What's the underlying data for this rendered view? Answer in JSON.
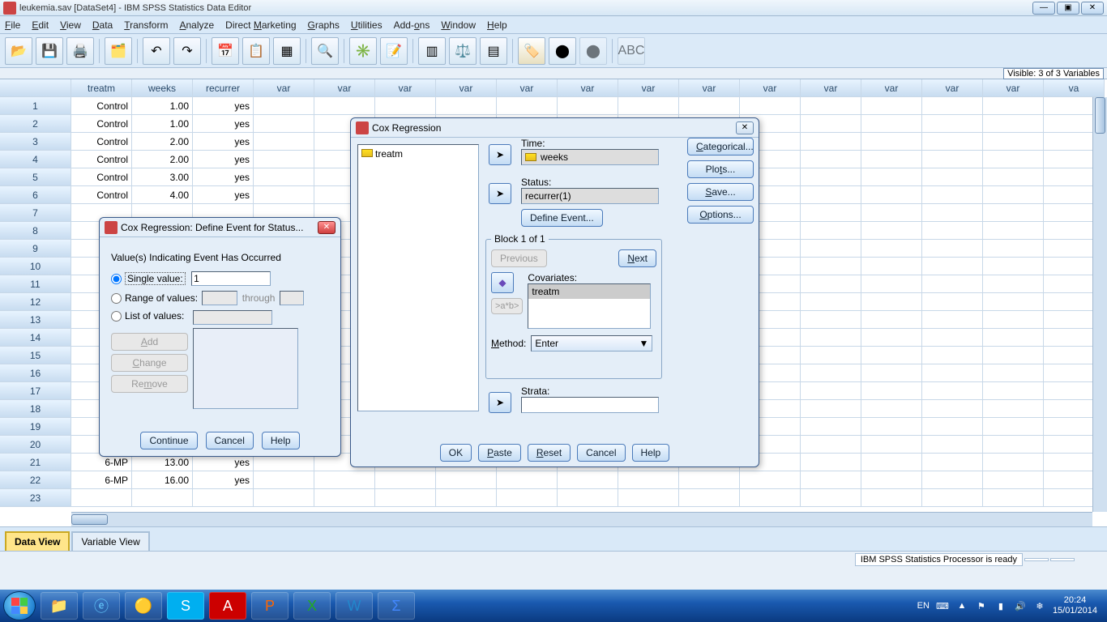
{
  "window": {
    "title": "leukemia.sav [DataSet4] - IBM SPSS Statistics Data Editor"
  },
  "menu": [
    "File",
    "Edit",
    "View",
    "Data",
    "Transform",
    "Analyze",
    "Direct Marketing",
    "Graphs",
    "Utilities",
    "Add-ons",
    "Window",
    "Help"
  ],
  "visible": "Visible: 3 of 3 Variables",
  "columns": [
    "treatm",
    "weeks",
    "recurrer",
    "var",
    "var",
    "var",
    "var",
    "var",
    "var",
    "var",
    "var",
    "var",
    "var",
    "var",
    "var",
    "var",
    "va"
  ],
  "rows": [
    {
      "n": "1",
      "c": [
        "Control",
        "1.00",
        "yes"
      ]
    },
    {
      "n": "2",
      "c": [
        "Control",
        "1.00",
        "yes"
      ]
    },
    {
      "n": "3",
      "c": [
        "Control",
        "2.00",
        "yes"
      ]
    },
    {
      "n": "4",
      "c": [
        "Control",
        "2.00",
        "yes"
      ]
    },
    {
      "n": "5",
      "c": [
        "Control",
        "3.00",
        "yes"
      ]
    },
    {
      "n": "6",
      "c": [
        "Control",
        "4.00",
        "yes"
      ]
    },
    {
      "n": "7",
      "c": [
        "",
        "",
        ""
      ]
    },
    {
      "n": "8",
      "c": [
        "",
        "",
        ""
      ]
    },
    {
      "n": "9",
      "c": [
        "",
        "",
        ""
      ]
    },
    {
      "n": "10",
      "c": [
        "",
        "",
        ""
      ]
    },
    {
      "n": "11",
      "c": [
        "",
        "",
        ""
      ]
    },
    {
      "n": "12",
      "c": [
        "",
        "",
        ""
      ]
    },
    {
      "n": "13",
      "c": [
        "",
        "",
        ""
      ]
    },
    {
      "n": "14",
      "c": [
        "",
        "",
        ""
      ]
    },
    {
      "n": "15",
      "c": [
        "",
        "",
        ""
      ]
    },
    {
      "n": "16",
      "c": [
        "",
        "",
        ""
      ]
    },
    {
      "n": "17",
      "c": [
        "",
        "",
        ""
      ]
    },
    {
      "n": "18",
      "c": [
        "",
        "",
        ""
      ]
    },
    {
      "n": "19",
      "c": [
        "",
        "",
        ""
      ]
    },
    {
      "n": "20",
      "c": [
        "",
        "",
        ""
      ]
    },
    {
      "n": "21",
      "c": [
        "6-MP",
        "13.00",
        "yes"
      ]
    },
    {
      "n": "22",
      "c": [
        "6-MP",
        "16.00",
        "yes"
      ]
    },
    {
      "n": "23",
      "c": [
        "",
        "",
        ""
      ]
    }
  ],
  "views": {
    "data": "Data View",
    "variable": "Variable View"
  },
  "status": "IBM SPSS Statistics Processor is ready",
  "cox": {
    "title": "Cox Regression",
    "source_item": "treatm",
    "time_lbl": "Time:",
    "time_val": "weeks",
    "status_lbl": "Status:",
    "status_val": "recurrer(1)",
    "define_event": "Define Event...",
    "block_legend": "Block 1 of 1",
    "previous": "Previous",
    "next": "Next",
    "covariates_lbl": "Covariates:",
    "covariate_val": "treatm",
    "ab": ">a*b>",
    "method_lbl": "Method:",
    "method_val": "Enter",
    "strata_lbl": "Strata:",
    "side": {
      "categorical": "Categorical...",
      "plots": "Plots...",
      "save": "Save...",
      "options": "Options..."
    },
    "ok": "OK",
    "paste": "Paste",
    "reset": "Reset",
    "cancel": "Cancel",
    "help": "Help"
  },
  "event": {
    "title": "Cox Regression: Define Event for Status...",
    "heading": "Value(s) Indicating Event Has Occurred",
    "single": "Single value:",
    "single_val": "1",
    "range": "Range of values:",
    "through": "through",
    "list": "List of values:",
    "add": "Add",
    "change": "Change",
    "remove": "Remove",
    "continue": "Continue",
    "cancel": "Cancel",
    "help": "Help"
  },
  "taskbar": {
    "lang": "EN",
    "time": "20:24",
    "date": "15/01/2014"
  }
}
